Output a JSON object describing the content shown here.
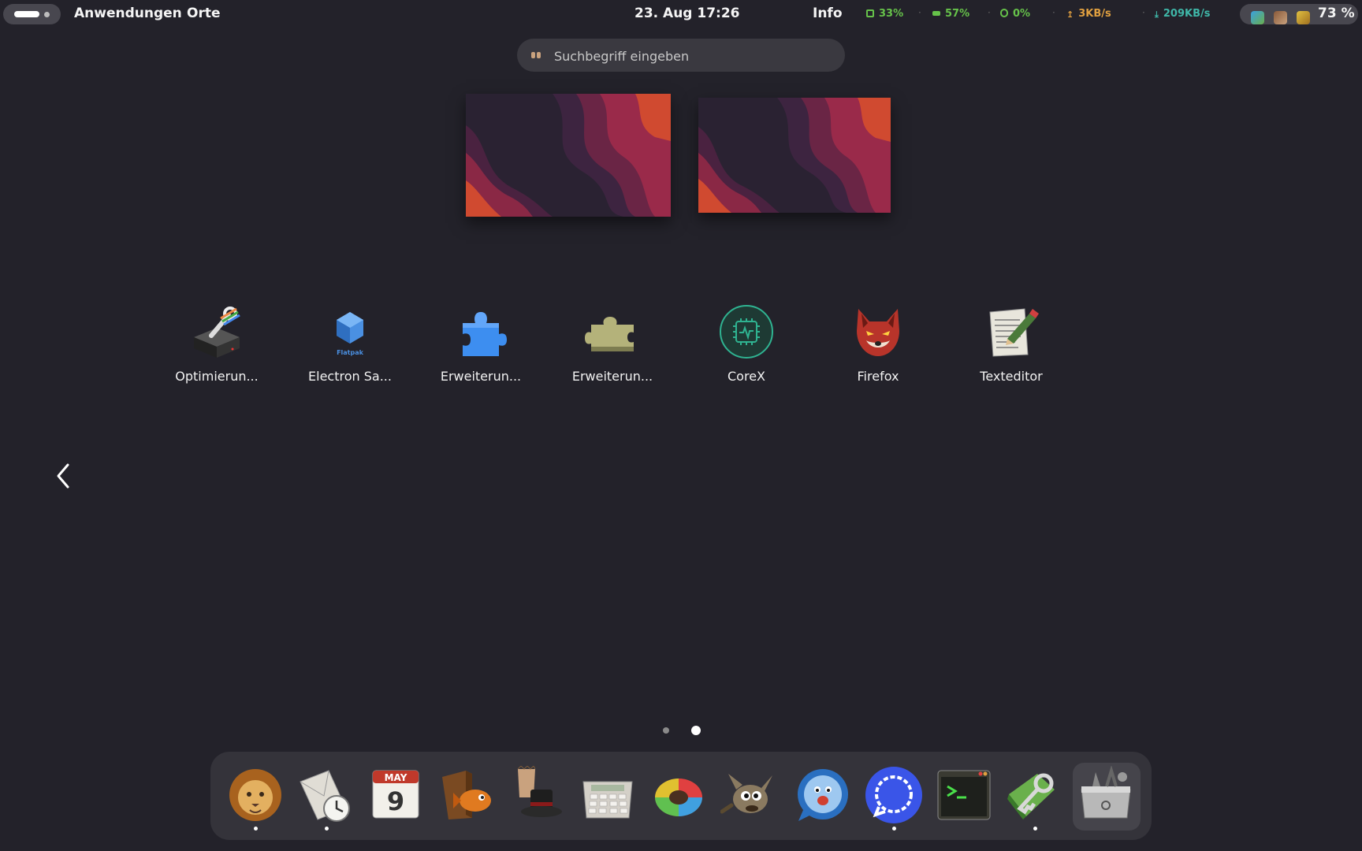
{
  "topbar": {
    "menu_apps": "Anwendungen",
    "menu_places": "Orte",
    "datetime": "23. Aug  17:26",
    "info": "Info",
    "indicators": [
      {
        "icon": "cpu-icon",
        "value": "33%",
        "color": "#66c24a"
      },
      {
        "icon": "memory-icon",
        "value": "57%",
        "color": "#66c24a"
      },
      {
        "icon": "disk-icon",
        "value": "0%",
        "color": "#66c24a"
      },
      {
        "icon": "upload-icon",
        "value": "3KB/s",
        "color": "#e0a040"
      },
      {
        "icon": "download-icon",
        "value": "209KB/s",
        "color": "#3fb7a8"
      }
    ],
    "battery": "73 %"
  },
  "search": {
    "placeholder": "Suchbegriff eingeben"
  },
  "apps": [
    {
      "name": "optimierungen",
      "label": "Optimierun..."
    },
    {
      "name": "electron-sandbox",
      "label": "Electron Sa...",
      "badge": "Flatpak"
    },
    {
      "name": "erweiterungen-1",
      "label": "Erweiterun..."
    },
    {
      "name": "erweiterungen-2",
      "label": "Erweiterun..."
    },
    {
      "name": "corex",
      "label": "CoreX"
    },
    {
      "name": "firefox",
      "label": "Firefox"
    },
    {
      "name": "texteditor",
      "label": "Texteditor"
    }
  ],
  "pagination": {
    "pages": 2,
    "current": 2
  },
  "dock": {
    "calendar_month": "MAY",
    "calendar_day": "9",
    "items": [
      "lion-icon",
      "mail-clock-icon",
      "calendar-icon",
      "fish-box-icon",
      "magician-hat-icon",
      "calculator-icon",
      "color-wheel-icon",
      "gimp-icon",
      "messenger-icon",
      "signal-icon",
      "terminal-icon",
      "keyring-icon",
      "software-tools-icon"
    ]
  },
  "colors": {
    "background": "#23222a",
    "dock": "#34333a",
    "accent_blue": "#3a55e8"
  }
}
